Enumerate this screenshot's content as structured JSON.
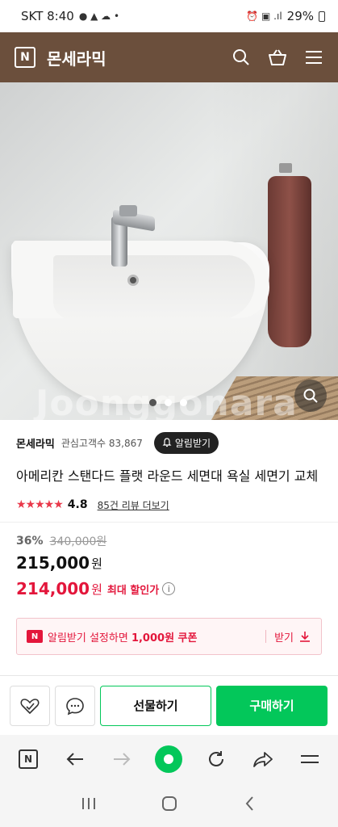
{
  "status_bar": {
    "carrier_time": "SKT 8:40",
    "battery": "29%"
  },
  "header": {
    "logo_letter": "N",
    "store_name": "몬세라믹",
    "icons": [
      "search-icon",
      "cart-icon",
      "menu-icon"
    ]
  },
  "hero": {
    "watermark": "Joonggonara",
    "dots": 3,
    "active_dot": 1
  },
  "store": {
    "name": "몬세라믹",
    "followers": "관심고객수 83,867",
    "alarm_label": "알림받기"
  },
  "product": {
    "title": "아메리칸 스탠다드 플랫 라운드 세면대 욕실 세면기 교체",
    "stars": "★★★★★",
    "rating": "4.8",
    "reviews": "85건 리뷰 더보기"
  },
  "price": {
    "discount": "36%",
    "original": "340,000원",
    "sale": "215,000",
    "sale_unit": "원",
    "best": "214,000",
    "best_unit": "원",
    "best_label": "최대 할인가",
    "info": "i"
  },
  "coupon": {
    "badge": "N",
    "text_pre": "알림받기 설정하면 ",
    "text_bold": "1,000원 쿠폰",
    "get_label": "받기"
  },
  "buy_bar": {
    "gift_label": "선물하기",
    "buy_label": "구매하기"
  },
  "browser_bar": {
    "logo_letter": "N"
  },
  "colors": {
    "header_brown": "#6b4f3c",
    "naver_green": "#03c75a",
    "accent_red": "#e3163b"
  }
}
